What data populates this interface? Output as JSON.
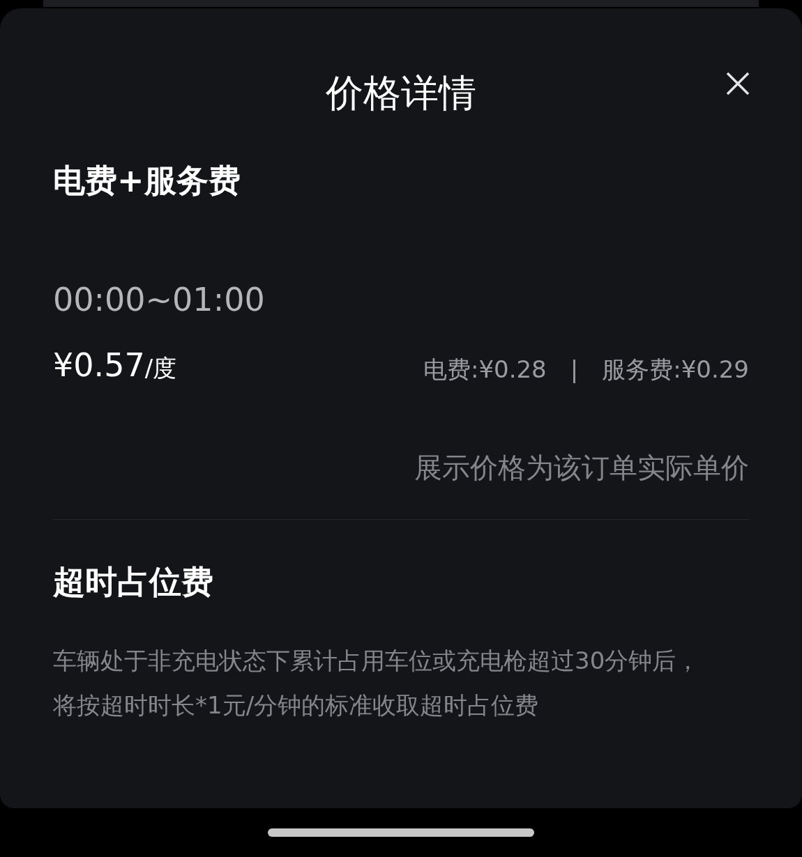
{
  "sheet": {
    "title": "价格详情"
  },
  "sections": [
    {
      "kind": "price",
      "heading": "电费+服务费",
      "time": "00:00~01:00",
      "price": "¥0.57",
      "unit": "/度",
      "breakdown": [
        "电费:¥0.28",
        "服务费:¥0.29"
      ],
      "separator": "|",
      "note": "展示价格为该订单实际单价"
    },
    {
      "kind": "text",
      "heading": "超时占位费",
      "body": "车辆处于非充电状态下累计占用车位或充电枪超过30分钟后，将按超时时长*1元/分钟的标准收取超时占位费"
    }
  ]
}
